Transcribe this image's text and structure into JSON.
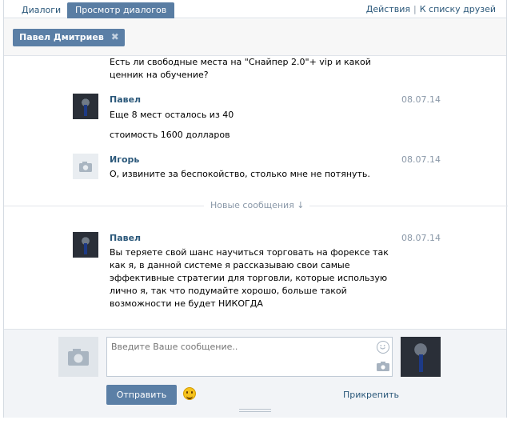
{
  "tabs": {
    "dialogs": "Диалоги",
    "view_dialogs": "Просмотр диалогов",
    "actions": "Действия",
    "separator": "|",
    "friends_list": "К списку друзей"
  },
  "recipient": {
    "name": "Павел Дмитриев",
    "remove": "✖"
  },
  "messages": [
    {
      "author": "",
      "date": "",
      "lines": [
        "Есть ли свободные места на \"Снайпер 2.0\"+ vip и какой ценник на обучение?"
      ]
    },
    {
      "author": "Павел",
      "date": "08.07.14",
      "lines": [
        "Еще 8 мест осталось из 40",
        "стоимость 1600 долларов"
      ]
    },
    {
      "author": "Игорь",
      "date": "08.07.14",
      "lines": [
        "О, извините за беспокойство, столько мне не потянуть."
      ]
    },
    {
      "author": "Павел",
      "date": "08.07.14",
      "lines": [
        "Вы теряете свой шанс научиться торговать на форексе так как я, в данной системе я рассказываю свои самые эффективные стратегии для торговли, которые использую лично я, так что подумайте хорошо, больше такой возможности не будет НИКОГДА"
      ]
    }
  ],
  "new_messages_label": "Новые сообщения ↓",
  "compose": {
    "placeholder": "Введите Ваше сообщение..",
    "send_label": "Отправить",
    "attach_label": "Прикрепить"
  },
  "colors": {
    "accent": "#597da3",
    "link": "#2b587a",
    "muted": "#8a98a8"
  },
  "icons": [
    "camera-icon",
    "smile-icon",
    "close-icon",
    "arrow-down-icon"
  ]
}
